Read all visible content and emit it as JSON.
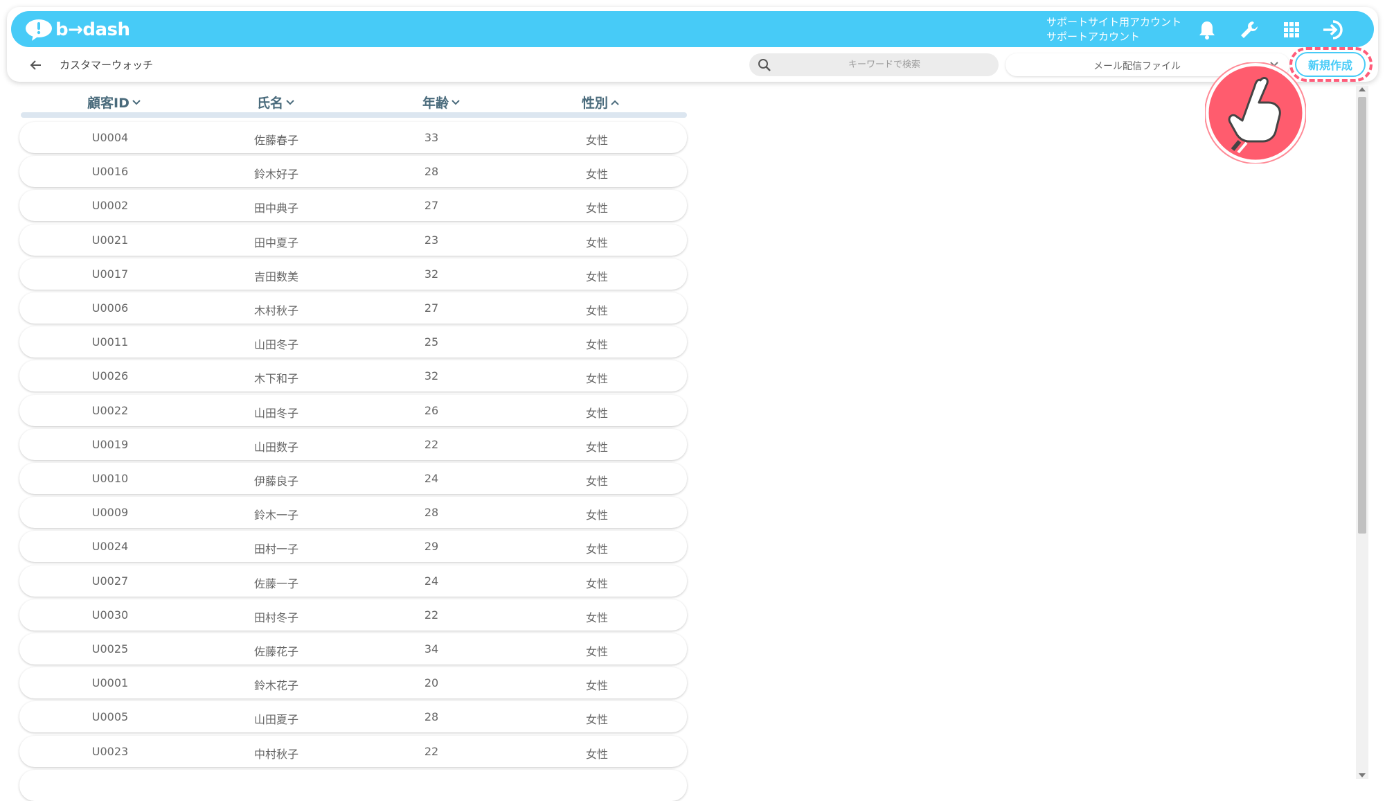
{
  "app": {
    "logo_text": "b→dash",
    "account_line1": "サポートサイト用アカウント",
    "account_line2": "サポートアカウント"
  },
  "toolbar": {
    "page_title": "カスタマーウォッチ",
    "search_placeholder": "キーワードで検索",
    "file_select_value": "メール配信ファイル",
    "new_button_label": "新規作成"
  },
  "table": {
    "headers": [
      "顧客ID",
      "氏名",
      "年齢",
      "性別"
    ],
    "sort_directions": [
      "down",
      "down",
      "down",
      "up"
    ],
    "rows": [
      [
        "U0004",
        "佐藤春子",
        "33",
        "女性"
      ],
      [
        "U0016",
        "鈴木好子",
        "28",
        "女性"
      ],
      [
        "U0002",
        "田中典子",
        "27",
        "女性"
      ],
      [
        "U0021",
        "田中夏子",
        "23",
        "女性"
      ],
      [
        "U0017",
        "吉田数美",
        "32",
        "女性"
      ],
      [
        "U0006",
        "木村秋子",
        "27",
        "女性"
      ],
      [
        "U0011",
        "山田冬子",
        "25",
        "女性"
      ],
      [
        "U0026",
        "木下和子",
        "32",
        "女性"
      ],
      [
        "U0022",
        "山田冬子",
        "26",
        "女性"
      ],
      [
        "U0019",
        "山田数子",
        "22",
        "女性"
      ],
      [
        "U0010",
        "伊藤良子",
        "24",
        "女性"
      ],
      [
        "U0009",
        "鈴木一子",
        "28",
        "女性"
      ],
      [
        "U0024",
        "田村一子",
        "29",
        "女性"
      ],
      [
        "U0027",
        "佐藤一子",
        "24",
        "女性"
      ],
      [
        "U0030",
        "田村冬子",
        "22",
        "女性"
      ],
      [
        "U0025",
        "佐藤花子",
        "34",
        "女性"
      ],
      [
        "U0001",
        "鈴木花子",
        "20",
        "女性"
      ],
      [
        "U0005",
        "山田夏子",
        "28",
        "女性"
      ],
      [
        "U0023",
        "中村秋子",
        "22",
        "女性"
      ]
    ]
  },
  "colors": {
    "brand": "#47cbf7",
    "highlight": "#ff5c7a",
    "header_text": "#4a6b7c"
  },
  "icons": [
    "chat-bubble-logo-icon",
    "bell-icon",
    "wrench-icon",
    "grid-icon",
    "logout-icon",
    "back-arrow-icon",
    "search-icon",
    "chevron-down-icon",
    "hand-pointer-icon"
  ]
}
